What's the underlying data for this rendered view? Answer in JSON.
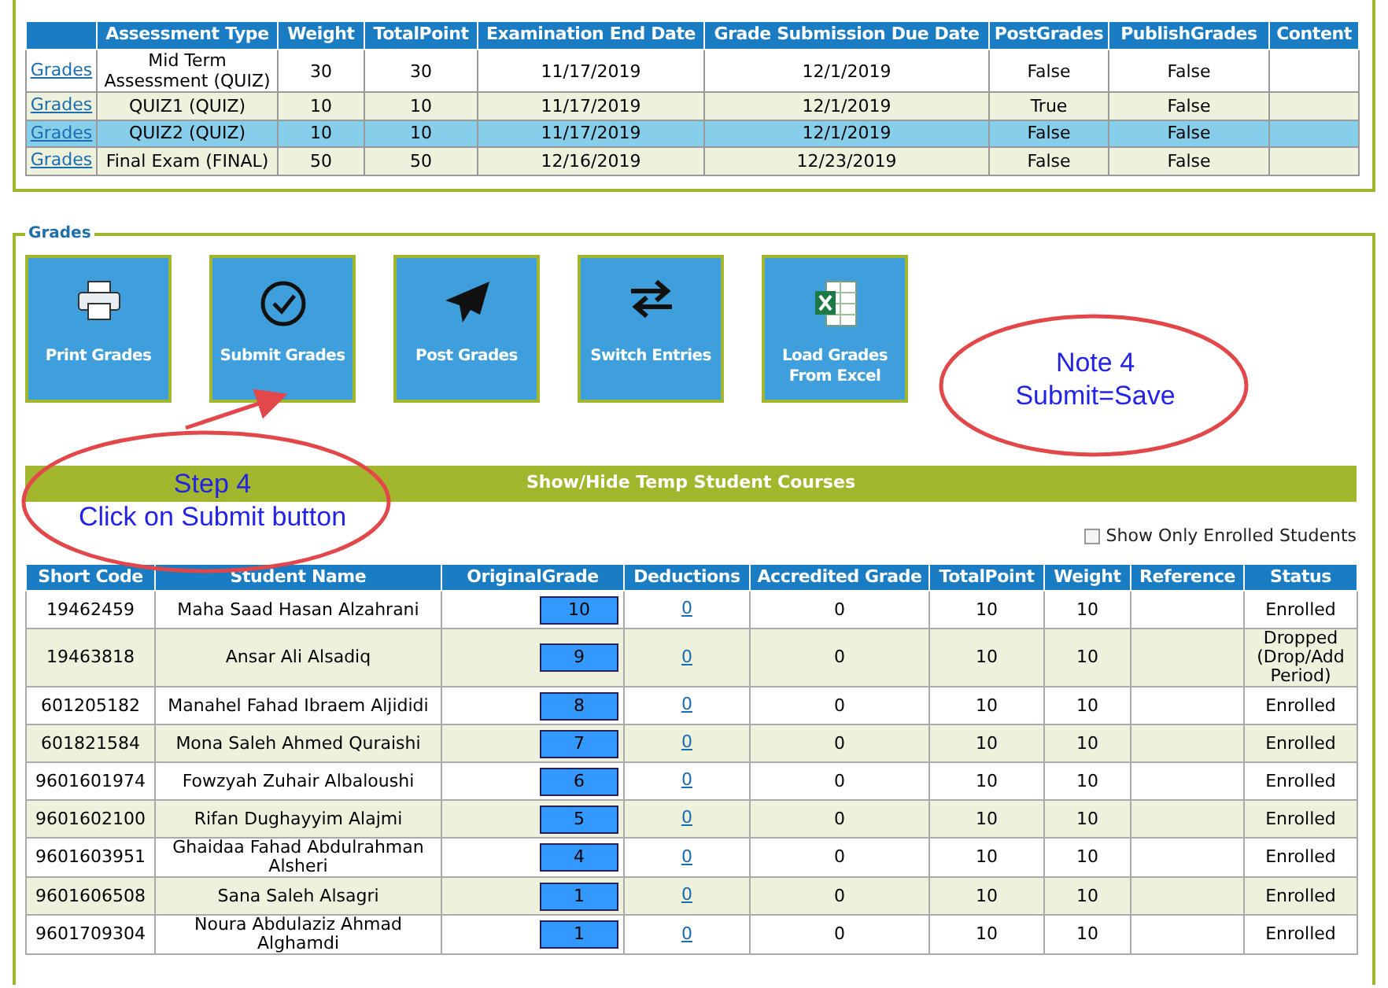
{
  "assessments": {
    "columns": [
      "",
      "Assessment Type",
      "Weight",
      "TotalPoint",
      "Examination End Date",
      "Grade Submission Due Date",
      "PostGrades",
      "PublishGrades",
      "Content"
    ],
    "rows": [
      {
        "link": "Grades",
        "type": "Mid Term Assessment (QUIZ)",
        "weight": "30",
        "total": "30",
        "end": "11/17/2019",
        "due": "12/1/2019",
        "post": "False",
        "publish": "False",
        "selected": false
      },
      {
        "link": "Grades",
        "type": "QUIZ1 (QUIZ)",
        "weight": "10",
        "total": "10",
        "end": "11/17/2019",
        "due": "12/1/2019",
        "post": "True",
        "publish": "False",
        "selected": false
      },
      {
        "link": "Grades",
        "type": "QUIZ2 (QUIZ)",
        "weight": "10",
        "total": "10",
        "end": "11/17/2019",
        "due": "12/1/2019",
        "post": "False",
        "publish": "False",
        "selected": true
      },
      {
        "link": "Grades",
        "type": "Final Exam (FINAL)",
        "weight": "50",
        "total": "50",
        "end": "12/16/2019",
        "due": "12/23/2019",
        "post": "False",
        "publish": "False",
        "selected": false
      }
    ]
  },
  "grades_panel": {
    "legend": "Grades",
    "buttons": [
      {
        "kind": "printer",
        "label": "Print Grades"
      },
      {
        "kind": "check",
        "label": "Submit Grades"
      },
      {
        "kind": "plane",
        "label": "Post Grades"
      },
      {
        "kind": "swap",
        "label": "Switch Entries"
      },
      {
        "kind": "excel",
        "label": "Load Grades From Excel"
      }
    ],
    "toggle_bar": "Show/Hide Temp Student Courses",
    "enrolled_only": {
      "label": "Show Only Enrolled Students",
      "checked": false
    },
    "students": {
      "columns": [
        "Short Code",
        "Student Name",
        "OriginalGrade",
        "Deductions",
        "Accredited Grade",
        "TotalPoint",
        "Weight",
        "Reference",
        "Status"
      ],
      "rows": [
        {
          "code": "19462459",
          "name": "Maha Saad Hasan Alzahrani",
          "grade": "10",
          "deductions": "0",
          "accredited": "0",
          "total": "10",
          "weight": "10",
          "status": "Enrolled"
        },
        {
          "code": "19463818",
          "name": "Ansar Ali Alsadiq",
          "grade": "9",
          "deductions": "0",
          "accredited": "0",
          "total": "10",
          "weight": "10",
          "status": "Dropped (Drop/Add Period)"
        },
        {
          "code": "601205182",
          "name": "Manahel Fahad Ibraem Aljididi",
          "grade": "8",
          "deductions": "0",
          "accredited": "0",
          "total": "10",
          "weight": "10",
          "status": "Enrolled"
        },
        {
          "code": "601821584",
          "name": "Mona Saleh Ahmed Quraishi",
          "grade": "7",
          "deductions": "0",
          "accredited": "0",
          "total": "10",
          "weight": "10",
          "status": "Enrolled"
        },
        {
          "code": "9601601974",
          "name": "Fowzyah Zuhair Albaloushi",
          "grade": "6",
          "deductions": "0",
          "accredited": "0",
          "total": "10",
          "weight": "10",
          "status": "Enrolled"
        },
        {
          "code": "9601602100",
          "name": "Rifan Dughayyim Alajmi",
          "grade": "5",
          "deductions": "0",
          "accredited": "0",
          "total": "10",
          "weight": "10",
          "status": "Enrolled"
        },
        {
          "code": "9601603951",
          "name": "Ghaidaa Fahad Abdulrahman Alsheri",
          "grade": "4",
          "deductions": "0",
          "accredited": "0",
          "total": "10",
          "weight": "10",
          "status": "Enrolled"
        },
        {
          "code": "9601606508",
          "name": "Sana Saleh Alsagri",
          "grade": "1",
          "deductions": "0",
          "accredited": "0",
          "total": "10",
          "weight": "10",
          "status": "Enrolled"
        },
        {
          "code": "9601709304",
          "name": "Noura Abdulaziz Ahmad Alghamdi",
          "grade": "1",
          "deductions": "0",
          "accredited": "0",
          "total": "10",
          "weight": "10",
          "status": "Enrolled"
        }
      ]
    }
  },
  "annotations": [
    {
      "kind": "note",
      "lines": [
        "Note 4",
        "Submit=Save"
      ]
    },
    {
      "kind": "step",
      "lines": [
        "Step 4",
        "Click on Submit button"
      ]
    }
  ]
}
